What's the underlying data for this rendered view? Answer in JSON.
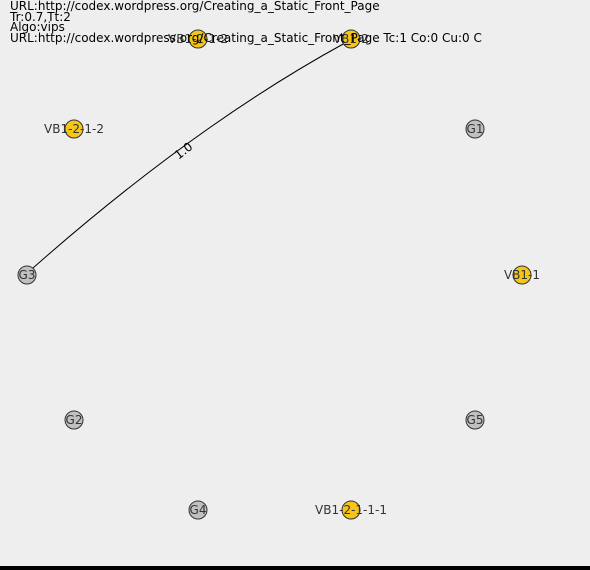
{
  "header": {
    "url_line": "URL:http://codex.wordpress.org/Creating_a_Static_Front_Page",
    "params_line": "Tr:0.7,Tt:2",
    "algo_line": "Algo:vips",
    "detail_line": "URL:http://codex.wordpress.org/Creating_a_Static_Front_Page Tc:1 Co:0 Cu:0 C"
  },
  "colors": {
    "vb_node": "#f5c518",
    "g_node": "#c0c0c0",
    "background": "#eeeeee"
  },
  "nodes": [
    {
      "id": "VB1-2-1-2",
      "label": "VB1-2-1-2",
      "kind": "vb"
    },
    {
      "id": "VB1-2",
      "label": "VB1-2",
      "kind": "vb"
    },
    {
      "id": "VB1-2-1-2b",
      "label": "VB1-2-1-2",
      "kind": "vb"
    },
    {
      "id": "G1",
      "label": "G1",
      "kind": "g"
    },
    {
      "id": "G3",
      "label": "G3",
      "kind": "g"
    },
    {
      "id": "VB1-1",
      "label": "VB1-1",
      "kind": "vb"
    },
    {
      "id": "G2",
      "label": "G2",
      "kind": "g"
    },
    {
      "id": "G5",
      "label": "G5",
      "kind": "g"
    },
    {
      "id": "G4",
      "label": "G4",
      "kind": "g"
    },
    {
      "id": "VB1-2-1-1-1",
      "label": "VB1-2-1-1-1",
      "kind": "vb"
    }
  ],
  "edges": [
    {
      "from": "G3",
      "to": "VB1-2",
      "weight": "1.0"
    }
  ]
}
